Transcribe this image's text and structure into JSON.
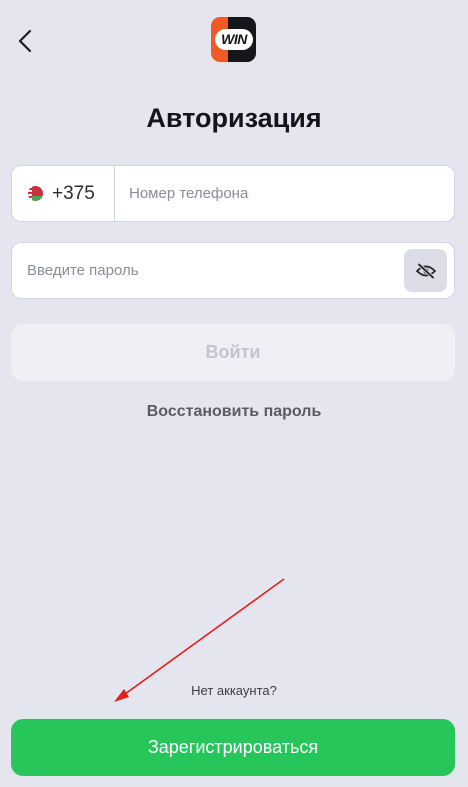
{
  "header": {
    "logo_text": "WIN",
    "back_icon": "chevron-left-icon"
  },
  "page": {
    "title": "Авторизация"
  },
  "form": {
    "country_code": "+375",
    "country_flag": "belarus-flag-icon",
    "phone_placeholder": "Номер телефона",
    "phone_value": "",
    "password_placeholder": "Введите пароль",
    "password_value": "",
    "password_toggle_icon": "eye-slash-icon",
    "login_label": "Войти",
    "recover_label": "Восстановить пароль"
  },
  "footer": {
    "no_account_text": "Нет аккаунта?",
    "register_label": "Зарегистрироваться"
  },
  "annotation": {
    "arrow_color": "#e0201b"
  },
  "colors": {
    "background": "#e4e5ef",
    "accent_green": "#27c65b",
    "brand_orange": "#f15a22",
    "disabled_button": "#eff0f5"
  }
}
